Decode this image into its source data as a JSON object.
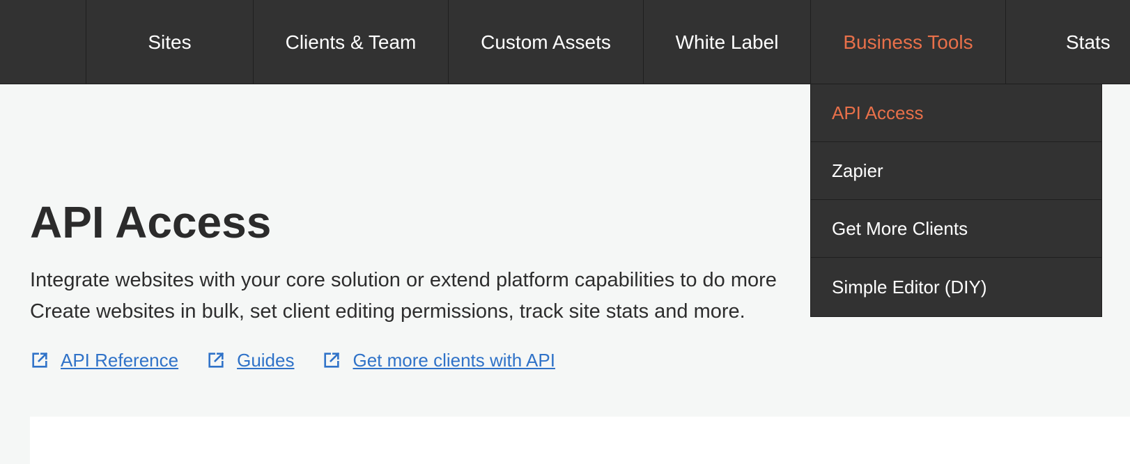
{
  "nav": {
    "items": [
      {
        "label": "Sites"
      },
      {
        "label": "Clients & Team"
      },
      {
        "label": "Custom Assets"
      },
      {
        "label": "White Label"
      },
      {
        "label": "Business Tools"
      },
      {
        "label": "Stats"
      }
    ],
    "active_color": "#e8704a"
  },
  "dropdown": {
    "items": [
      {
        "label": "API Access"
      },
      {
        "label": "Zapier"
      },
      {
        "label": "Get More Clients"
      },
      {
        "label": "Simple Editor (DIY)"
      }
    ]
  },
  "page": {
    "title": "API Access",
    "description_line1": "Integrate websites with your core solution or extend platform capabilities to do more",
    "description_line2": "Create websites in bulk, set client editing permissions, track site stats and more."
  },
  "links": [
    {
      "label": "API Reference",
      "icon": "external-link-icon"
    },
    {
      "label": "Guides",
      "icon": "external-link-icon"
    },
    {
      "label": "Get more clients with API",
      "icon": "external-link-icon"
    }
  ],
  "colors": {
    "nav_bg": "#323232",
    "link": "#2f72c8",
    "accent": "#e8704a"
  }
}
